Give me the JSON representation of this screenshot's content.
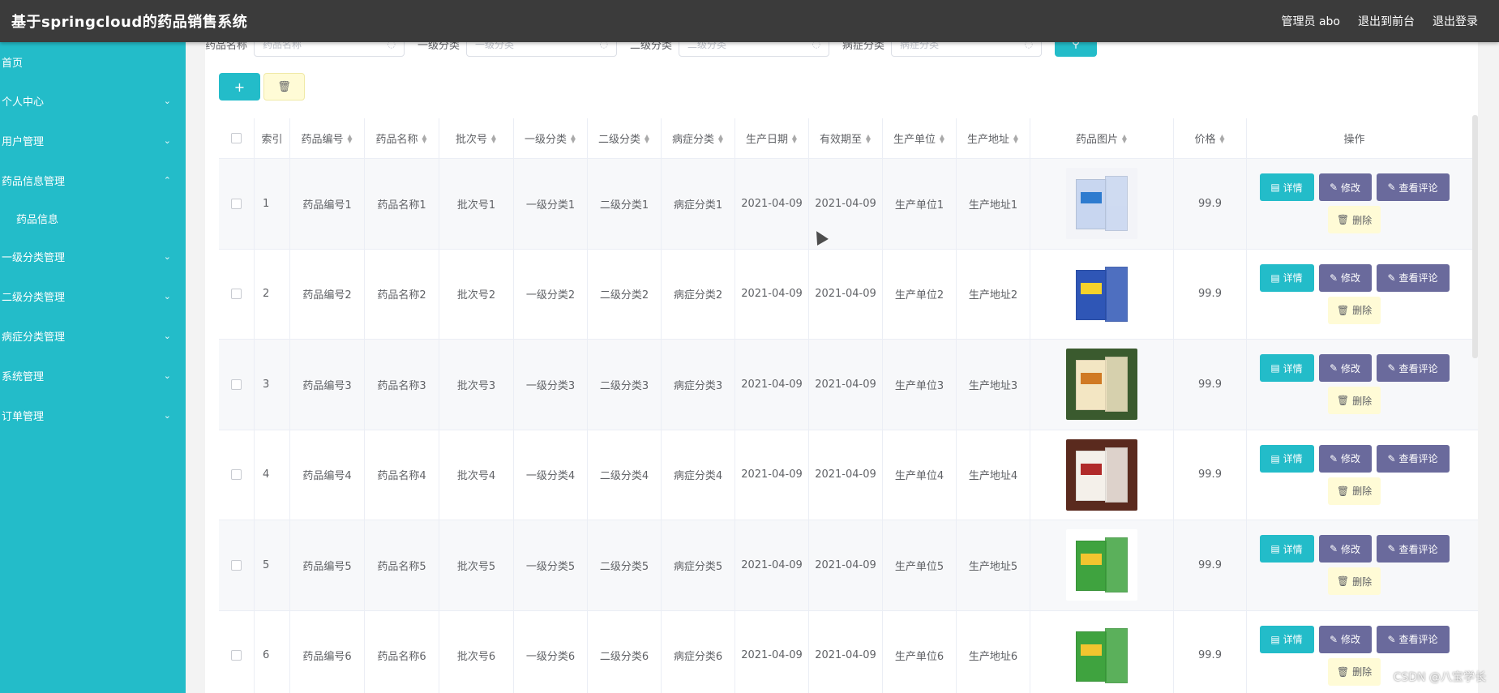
{
  "app": {
    "title": "基于springcloud的药品销售系统",
    "admin_label": "管理员 abo",
    "to_front": "退出到前台",
    "logout": "退出登录"
  },
  "sidebar": {
    "items": [
      {
        "label": "首页",
        "icon": "none"
      },
      {
        "label": "个人中心",
        "icon": "chevron-down"
      },
      {
        "label": "用户管理",
        "icon": "chevron-down"
      },
      {
        "label": "药品信息管理",
        "icon": "chevron-up"
      },
      {
        "label": "药品信息",
        "icon": "none"
      },
      {
        "label": "一级分类管理",
        "icon": "chevron-down"
      },
      {
        "label": "二级分类管理",
        "icon": "chevron-down"
      },
      {
        "label": "病症分类管理",
        "icon": "chevron-down"
      },
      {
        "label": "系统管理",
        "icon": "chevron-down"
      },
      {
        "label": "订单管理",
        "icon": "chevron-down"
      }
    ]
  },
  "search": {
    "name_label": "药品名称",
    "name_ph": "药品名称",
    "cat1_label": "一级分类",
    "cat1_ph": "一级分类",
    "cat2_label": "二级分类",
    "cat2_ph": "二级分类",
    "disease_label": "病症分类",
    "disease_ph": "病症分类",
    "search_icon": "search-icon"
  },
  "actions": {
    "add": "+",
    "delete_icon": "🗑"
  },
  "table": {
    "headers": [
      "索引",
      "药品编号",
      "药品名称",
      "批次号",
      "一级分类",
      "二级分类",
      "病症分类",
      "生产日期",
      "有效期至",
      "生产单位",
      "生产地址",
      "药品图片",
      "价格",
      "操作"
    ],
    "rows": [
      {
        "idx": "1",
        "code": "药品编号1",
        "name": "药品名称1",
        "batch": "批次号1",
        "cat1": "一级分类1",
        "cat2": "二级分类1",
        "disease": "病症分类1",
        "prod": "2021-04-09",
        "exp": "2021-04-09",
        "unit": "生产单位1",
        "addr": "生产地址1",
        "price": "99.9"
      },
      {
        "idx": "2",
        "code": "药品编号2",
        "name": "药品名称2",
        "batch": "批次号2",
        "cat1": "一级分类2",
        "cat2": "二级分类2",
        "disease": "病症分类2",
        "prod": "2021-04-09",
        "exp": "2021-04-09",
        "unit": "生产单位2",
        "addr": "生产地址2",
        "price": "99.9"
      },
      {
        "idx": "3",
        "code": "药品编号3",
        "name": "药品名称3",
        "batch": "批次号3",
        "cat1": "一级分类3",
        "cat2": "二级分类3",
        "disease": "病症分类3",
        "prod": "2021-04-09",
        "exp": "2021-04-09",
        "unit": "生产单位3",
        "addr": "生产地址3",
        "price": "99.9"
      },
      {
        "idx": "4",
        "code": "药品编号4",
        "name": "药品名称4",
        "batch": "批次号4",
        "cat1": "一级分类4",
        "cat2": "二级分类4",
        "disease": "病症分类4",
        "prod": "2021-04-09",
        "exp": "2021-04-09",
        "unit": "生产单位4",
        "addr": "生产地址4",
        "price": "99.9"
      },
      {
        "idx": "5",
        "code": "药品编号5",
        "name": "药品名称5",
        "batch": "批次号5",
        "cat1": "一级分类5",
        "cat2": "二级分类5",
        "disease": "病症分类5",
        "prod": "2021-04-09",
        "exp": "2021-04-09",
        "unit": "生产单位5",
        "addr": "生产地址5",
        "price": "99.9"
      },
      {
        "idx": "6",
        "code": "药品编号6",
        "name": "药品名称6",
        "batch": "批次号6",
        "cat1": "一级分类6",
        "cat2": "二级分类6",
        "disease": "病症分类6",
        "prod": "2021-04-09",
        "exp": "2021-04-09",
        "unit": "生产单位6",
        "addr": "生产地址6",
        "price": "99.9"
      }
    ],
    "ops": {
      "detail": "详情",
      "edit": "修改",
      "review": "查看评论",
      "remove": "删除"
    }
  },
  "colors": {
    "accent": "#23bcc9",
    "topbar": "#3b3b3b",
    "purple": "#6a6a9c",
    "yellow": "#fffbd6"
  },
  "watermark": "CSDN @八宝学长"
}
